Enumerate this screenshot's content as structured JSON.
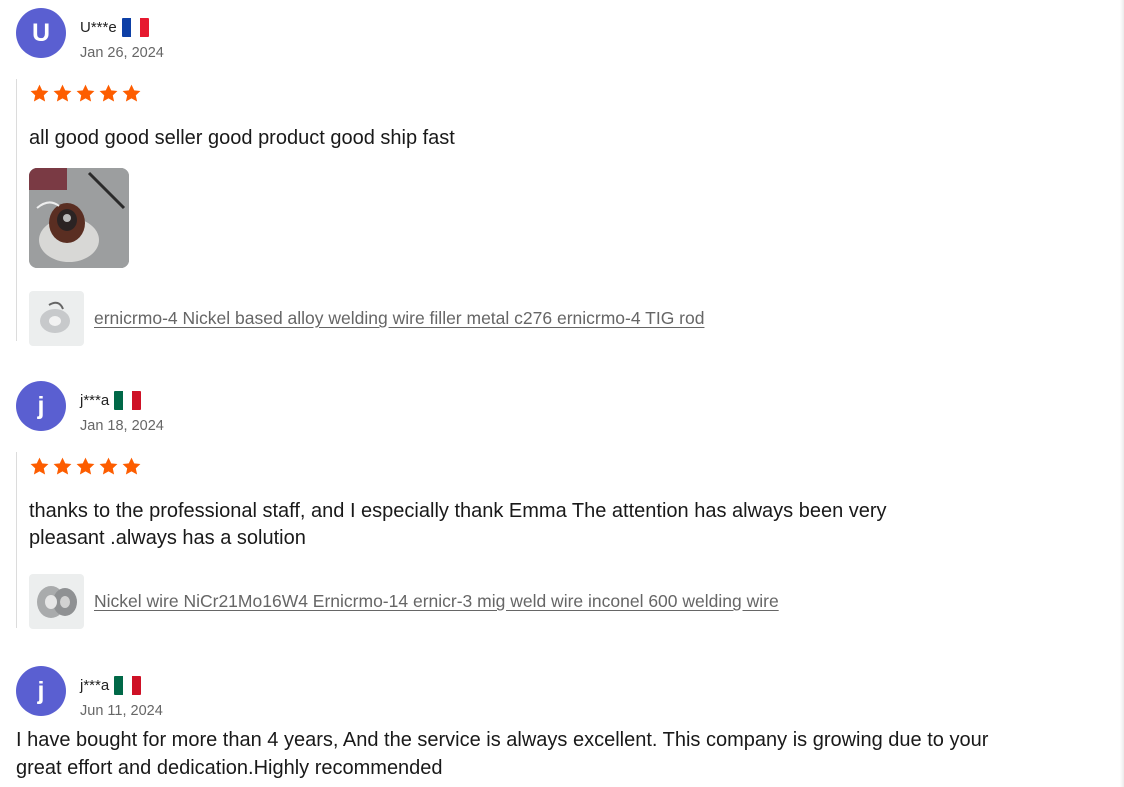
{
  "reviews": [
    {
      "avatar_letter": "U",
      "name": "U***e",
      "flag": "france-flag",
      "date": "Jan 26, 2024",
      "rating": 5,
      "text": "all good good seller good product good ship fast",
      "has_photo": true,
      "product": "ernicrmo-4 Nickel based alloy welding wire filler metal c276 ernicrmo-4 TIG rod"
    },
    {
      "avatar_letter": "j",
      "name": "j***a",
      "flag": "mexico-flag",
      "date": "Jan 18, 2024",
      "rating": 5,
      "text": "thanks to the professional staff, and I especially thank Emma The attention has always been very pleasant .always has a solution",
      "product": "Nickel wire NiCr21Mo16W4 Ernicrmo-14 ernicr-3 mig weld wire inconel 600 welding wire"
    },
    {
      "avatar_letter": "j",
      "name": "j***a",
      "flag": "mexico-flag",
      "date": "Jun 11, 2024",
      "text": "I have bought for more than 4 years, And the service is always excellent. This company is growing due to your great effort and dedication.Highly recommended"
    }
  ],
  "colors": {
    "avatar": "#5a5fd1",
    "star": "#fd5d00",
    "link": "#666666"
  }
}
